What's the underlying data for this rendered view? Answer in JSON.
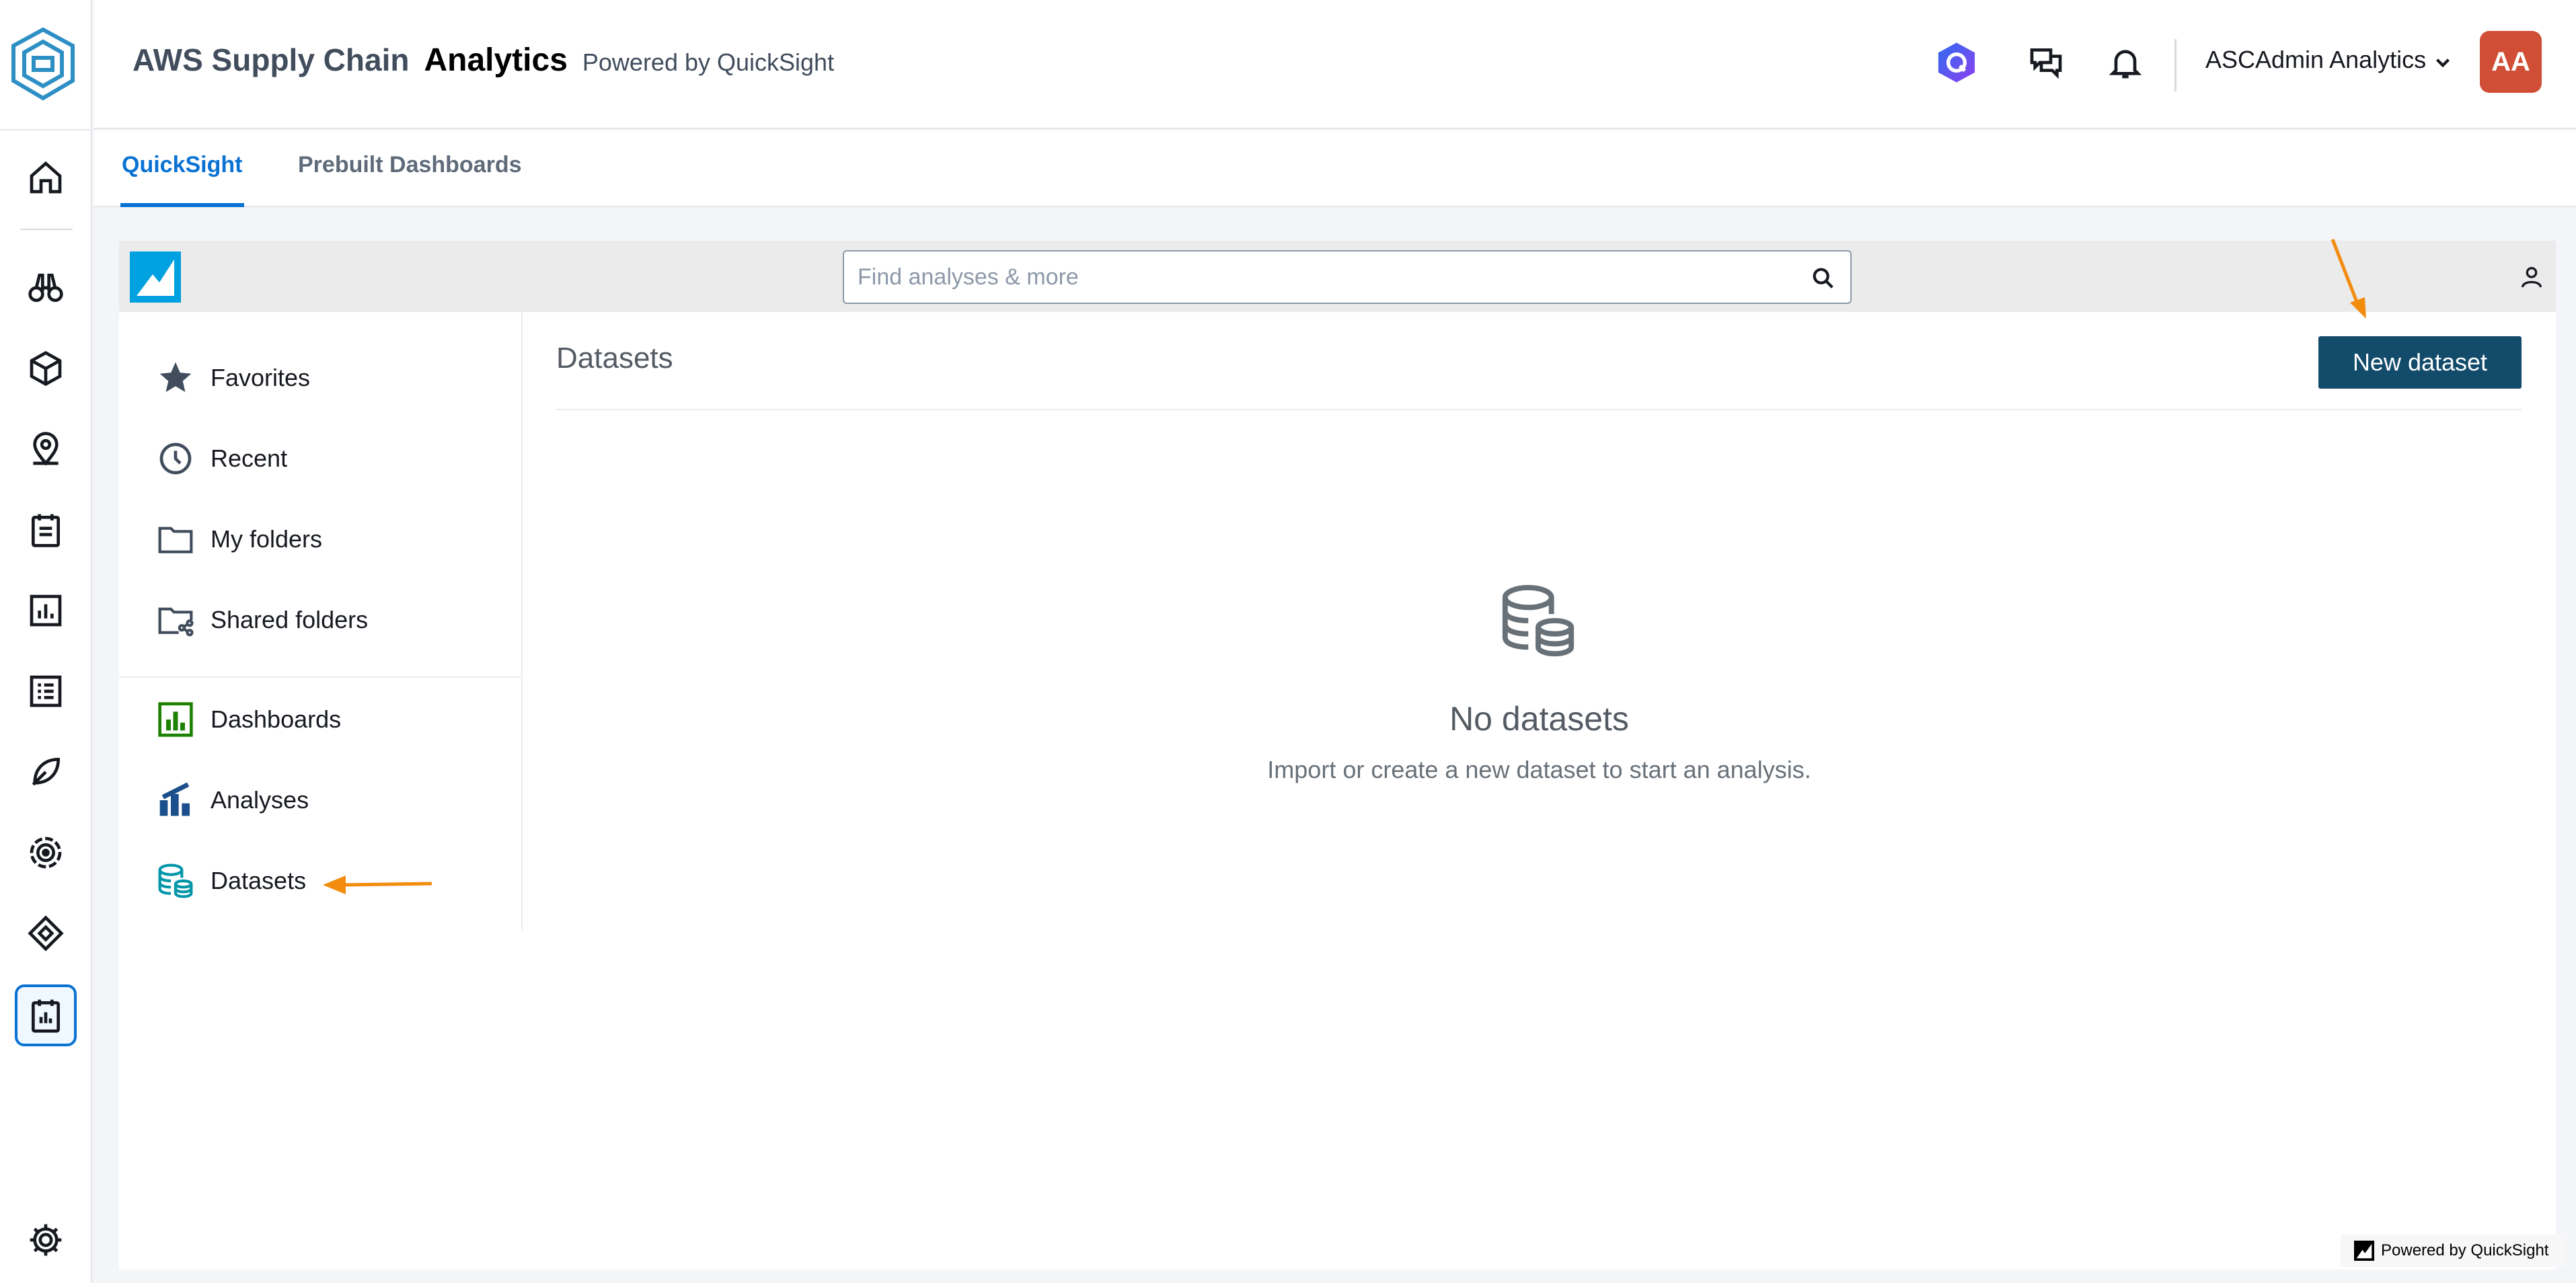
{
  "header": {
    "brand_main": "AWS Supply Chain",
    "brand_bold": "Analytics",
    "brand_sub": "Powered by QuickSight",
    "user_name": "ASCAdmin Analytics",
    "avatar_initials": "AA"
  },
  "tabs": [
    {
      "label": "QuickSight",
      "active": true
    },
    {
      "label": "Prebuilt Dashboards",
      "active": false
    }
  ],
  "search": {
    "placeholder": "Find analyses & more"
  },
  "sidebar": {
    "items": [
      {
        "label": "Favorites",
        "icon": "star-icon"
      },
      {
        "label": "Recent",
        "icon": "clock-icon"
      },
      {
        "label": "My folders",
        "icon": "folder-icon"
      },
      {
        "label": "Shared folders",
        "icon": "shared-folder-icon"
      },
      {
        "label": "Dashboards",
        "icon": "dashboard-icon"
      },
      {
        "label": "Analyses",
        "icon": "analysis-icon"
      },
      {
        "label": "Datasets",
        "icon": "dataset-icon"
      }
    ]
  },
  "main": {
    "title": "Datasets",
    "new_button": "New dataset",
    "empty_title": "No datasets",
    "empty_subtitle": "Import or create a new dataset to start an analysis."
  },
  "footer": {
    "powered": "Powered by QuickSight"
  },
  "colors": {
    "accent": "#0972d3",
    "button": "#134b6b",
    "avatar": "#d04e35",
    "arrow": "#f28c0f"
  }
}
